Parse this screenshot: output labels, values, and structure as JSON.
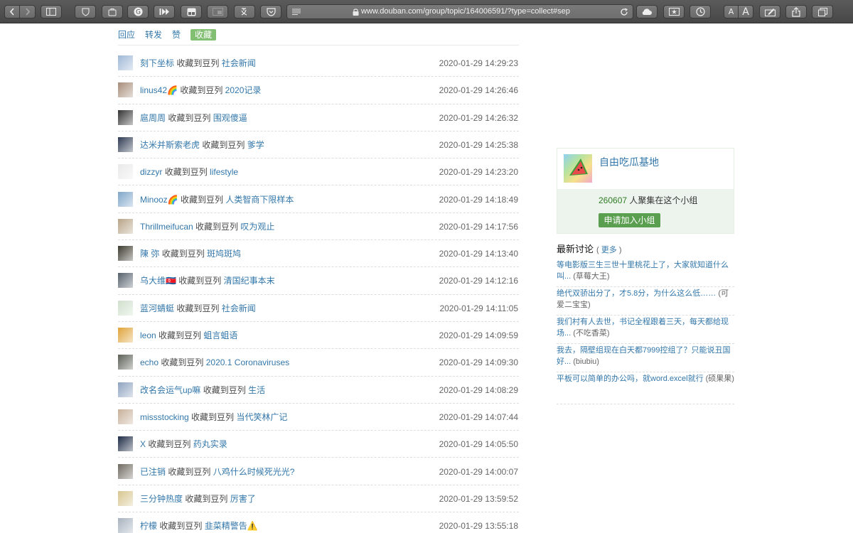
{
  "browser": {
    "url": "www.douban.com/group/topic/164006591/?type=collect#sep",
    "font_smaller_label": "A",
    "font_larger_label": "A"
  },
  "tabs": [
    {
      "label": "回应",
      "active": false
    },
    {
      "label": "转发",
      "active": false
    },
    {
      "label": "赞",
      "active": false
    },
    {
      "label": "收藏",
      "active": true
    }
  ],
  "action_text": "收藏到豆列",
  "collects": [
    {
      "user": "刻下坐标",
      "doulist": "社会新闻",
      "time": "2020-01-29 14:29:23",
      "avatar_color": "#9fb8d6"
    },
    {
      "user": "linus42🌈",
      "doulist": "2020记录",
      "time": "2020-01-29 14:26:46",
      "avatar_color": "#a78d7a"
    },
    {
      "user": "扈周周",
      "doulist": "围观傻逼",
      "time": "2020-01-29 14:26:32",
      "avatar_color": "#333333"
    },
    {
      "user": "达米并斯索老虎",
      "doulist": "爹学",
      "time": "2020-01-29 14:25:38",
      "avatar_color": "#2e3b52"
    },
    {
      "user": "dizzyr",
      "doulist": "lifestyle",
      "time": "2020-01-29 14:23:20",
      "avatar_color": "#e9e9e9"
    },
    {
      "user": "Minooz🌈",
      "doulist": "人类智商下限样本",
      "time": "2020-01-29 14:18:49",
      "avatar_color": "#7fa6c9"
    },
    {
      "user": "Thrillmeifucan",
      "doulist": "叹为观止",
      "time": "2020-01-29 14:17:56",
      "avatar_color": "#b8a487"
    },
    {
      "user": "陳 弥",
      "doulist": "斑鸠斑鸠",
      "time": "2020-01-29 14:13:40",
      "avatar_color": "#3c3a2e"
    },
    {
      "user": "乌大维🇰🇵",
      "doulist": "清国纪事本末",
      "time": "2020-01-29 14:12:16",
      "avatar_color": "#55606b"
    },
    {
      "user": "蓝河蜻蜓",
      "doulist": "社会新闻",
      "time": "2020-01-29 14:11:05",
      "avatar_color": "#cfe0cc"
    },
    {
      "user": "leon",
      "doulist": "蛆言蛆语",
      "time": "2020-01-29 14:09:59",
      "avatar_color": "#e0a43a"
    },
    {
      "user": "echo",
      "doulist": "2020.1 Coronaviruses",
      "time": "2020-01-29 14:09:30",
      "avatar_color": "#5a5f55"
    },
    {
      "user": "改名会运气up嘛",
      "doulist": "生活",
      "time": "2020-01-29 14:08:29",
      "avatar_color": "#8fa3c0"
    },
    {
      "user": "missstocking",
      "doulist": "当代笑林广记",
      "time": "2020-01-29 14:07:44",
      "avatar_color": "#c7b09a"
    },
    {
      "user": "X",
      "doulist": "药丸实录",
      "time": "2020-01-29 14:05:50",
      "avatar_color": "#1c2a44"
    },
    {
      "user": "已注销",
      "doulist": "八鸡什么时候死光光?",
      "time": "2020-01-29 14:00:07",
      "avatar_color": "#6f6a60"
    },
    {
      "user": "三分钟热度",
      "doulist": "厉害了",
      "time": "2020-01-29 13:59:52",
      "avatar_color": "#d7c690"
    },
    {
      "user": "柠檬",
      "doulist": "韭菜精警告⚠️",
      "time": "2020-01-29 13:55:18",
      "avatar_color": "#a7b2bf"
    }
  ],
  "group": {
    "name": "自由吃瓜基地",
    "member_count": "260607",
    "member_suffix": "人聚集在这个小组",
    "join_label": "申请加入小组"
  },
  "latest": {
    "heading": "最新讨论",
    "more_open": "(",
    "more_label": "更多",
    "more_close": ")",
    "items": [
      {
        "title": "等电影版三生三世十里桃花上了，大家就知道什么叫...",
        "author": "(草莓大王)"
      },
      {
        "title": "绝代双骄出分了，才5.8分，为什么这么低……",
        "author": "(可爱二宝宝)"
      },
      {
        "title": "我们村有人去世，书记全程跟着三天，每天都给现场...",
        "author": "(不吃香菜)"
      },
      {
        "title": "我去，隔壁组现在白天都7999控组了？只能说丑国好...",
        "author": "(biubiu)"
      },
      {
        "title": "平板可以简单的办公吗，就word.excel就行",
        "author": "(硕果果)"
      }
    ]
  }
}
